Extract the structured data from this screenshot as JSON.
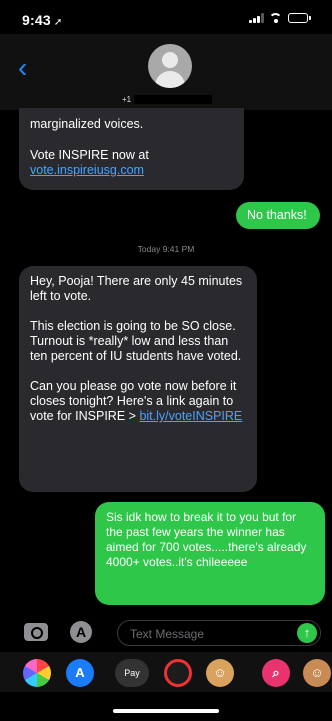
{
  "status": {
    "time": "9:43"
  },
  "header": {
    "contact_prefix": "+1"
  },
  "messages": {
    "m1": {
      "line1": "marginalized voices.",
      "line2": "Vote INSPIRE now at",
      "link": "vote.inspireiusg.com"
    },
    "reply1": "No thanks!",
    "timestamp": "Today 9:41 PM",
    "m2": {
      "p1": "Hey, Pooja! There are only 45 minutes left to vote.",
      "p2": "This election is going to be SO close. Turnout is *really* low and less than ten percent of IU students have voted.",
      "p3": "Can you please go vote now before it closes tonight? Here's a link again to vote for INSPIRE >",
      "link": "bit.ly/voteINSPIRE"
    },
    "reply2": "Sis idk how to break it to you but for the past few years the winner has aimed for 700 votes.....there's already 4000+ votes..it's chileeeee"
  },
  "composer": {
    "placeholder": "Text Message",
    "send_glyph": "↑",
    "apps_glyph": "A"
  },
  "apps": {
    "pay_label": "Pay"
  },
  "icons": {
    "back": "chevron-left",
    "camera": "camera",
    "app_store": "app-store",
    "send": "arrow-up"
  },
  "colors": {
    "outgoing": "#2fc74a",
    "incoming": "#2a2a2e",
    "link": "#4aa2ff",
    "accent": "#1a8cff"
  }
}
